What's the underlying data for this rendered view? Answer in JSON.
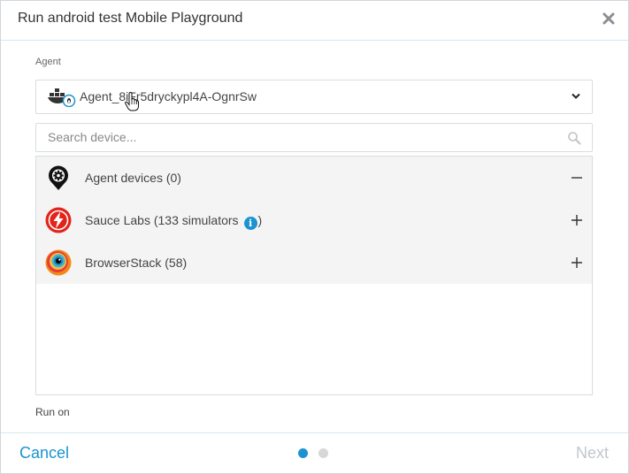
{
  "dialog": {
    "title": "Run android test Mobile Playground"
  },
  "agent": {
    "label": "Agent",
    "selected": "Agent_8iFr5dryckypl4A-OgnrSw"
  },
  "search": {
    "placeholder": "Search device..."
  },
  "device_groups": [
    {
      "name": "Agent devices (0)",
      "icon": "agent-device-pin-icon",
      "state": "expanded",
      "toggle": "minus-icon"
    },
    {
      "name_prefix": "Sauce Labs (133 simulators",
      "name_suffix": ")",
      "info": "i",
      "icon": "sauce-labs-icon",
      "state": "collapsed",
      "toggle": "plus-icon"
    },
    {
      "name": "BrowserStack (58)",
      "icon": "browserstack-icon",
      "state": "collapsed",
      "toggle": "plus-icon"
    }
  ],
  "run_on": {
    "label": "Run on"
  },
  "footer": {
    "cancel_label": "Cancel",
    "next_label": "Next",
    "step": {
      "current": 1,
      "total": 2
    }
  },
  "colors": {
    "accent": "#1b93d1",
    "disabled": "#c2c7cc",
    "row_bg": "#f4f4f4",
    "sauce_red": "#e2231a"
  }
}
